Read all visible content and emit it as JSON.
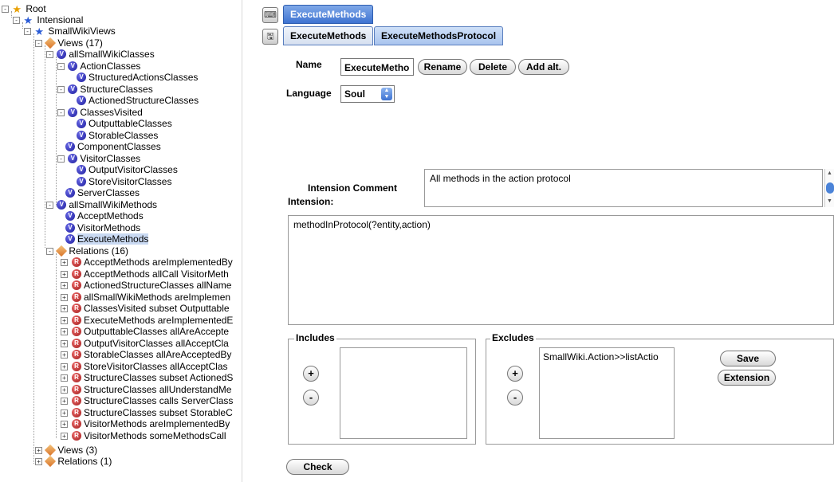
{
  "tree": {
    "root": "Root",
    "intensional": "Intensional",
    "smallwikiviews": "SmallWikiViews",
    "views17": "Views (17)",
    "allSmallWikiClasses": "allSmallWikiClasses",
    "actionClasses": "ActionClasses",
    "structuredActionsClasses": "StructuredActionsClasses",
    "structureClasses": "StructureClasses",
    "actionedStructureClasses": "ActionedStructureClasses",
    "classesVisited": "ClassesVisited",
    "outputtableClasses": "OutputtableClasses",
    "storableClasses": "StorableClasses",
    "componentClasses": "ComponentClasses",
    "visitorClasses": "VisitorClasses",
    "outputVisitorClasses": "OutputVisitorClasses",
    "storeVisitorClasses": "StoreVisitorClasses",
    "serverClasses": "ServerClasses",
    "allSmallWikiMethods": "allSmallWikiMethods",
    "acceptMethods": "AcceptMethods",
    "visitorMethods": "VisitorMethods",
    "executeMethods": "ExecuteMethods",
    "relations16": "Relations (16)",
    "relations": [
      "AcceptMethods areImplementedBy",
      "AcceptMethods allCall VisitorMeth",
      "ActionedStructureClasses allName",
      "allSmallWikiMethods areImplemen",
      "ClassesVisited subset Outputtable",
      "ExecuteMethods areImplementedE",
      "OutputtableClasses allAreAccepte",
      "OutputVisitorClasses allAcceptCla",
      "StorableClasses allAreAcceptedBy",
      "StoreVisitorClasses allAcceptClas",
      "StructureClasses subset ActionedS",
      "StructureClasses allUnderstandMe",
      "StructureClasses calls ServerClass",
      "StructureClasses subset StorableC",
      "VisitorMethods areImplementedBy",
      "VisitorMethods someMethodsCall "
    ],
    "views3": "Views (3)",
    "relations1": "Relations (1)"
  },
  "tabs": {
    "top": "ExecuteMethods",
    "sub1": "ExecuteMethods",
    "sub2": "ExecuteMethodsProtocol"
  },
  "form": {
    "name_label": "Name",
    "name_value": "ExecuteMetho",
    "rename": "Rename",
    "delete": "Delete",
    "add_alt": "Add alt.",
    "language_label": "Language",
    "language_value": "Soul",
    "comment_label": "Intension Comment",
    "comment_value": "All methods in the action protocol",
    "intension_label": "Intension:",
    "intension_value": "methodInProtocol(?entity,action)",
    "includes_label": "Includes",
    "excludes_label": "Excludes",
    "excludes_items": [
      "SmallWiki.Action>>listActio"
    ],
    "plus": "+",
    "minus": "-",
    "save": "Save",
    "extension": "Extension",
    "check": "Check"
  }
}
